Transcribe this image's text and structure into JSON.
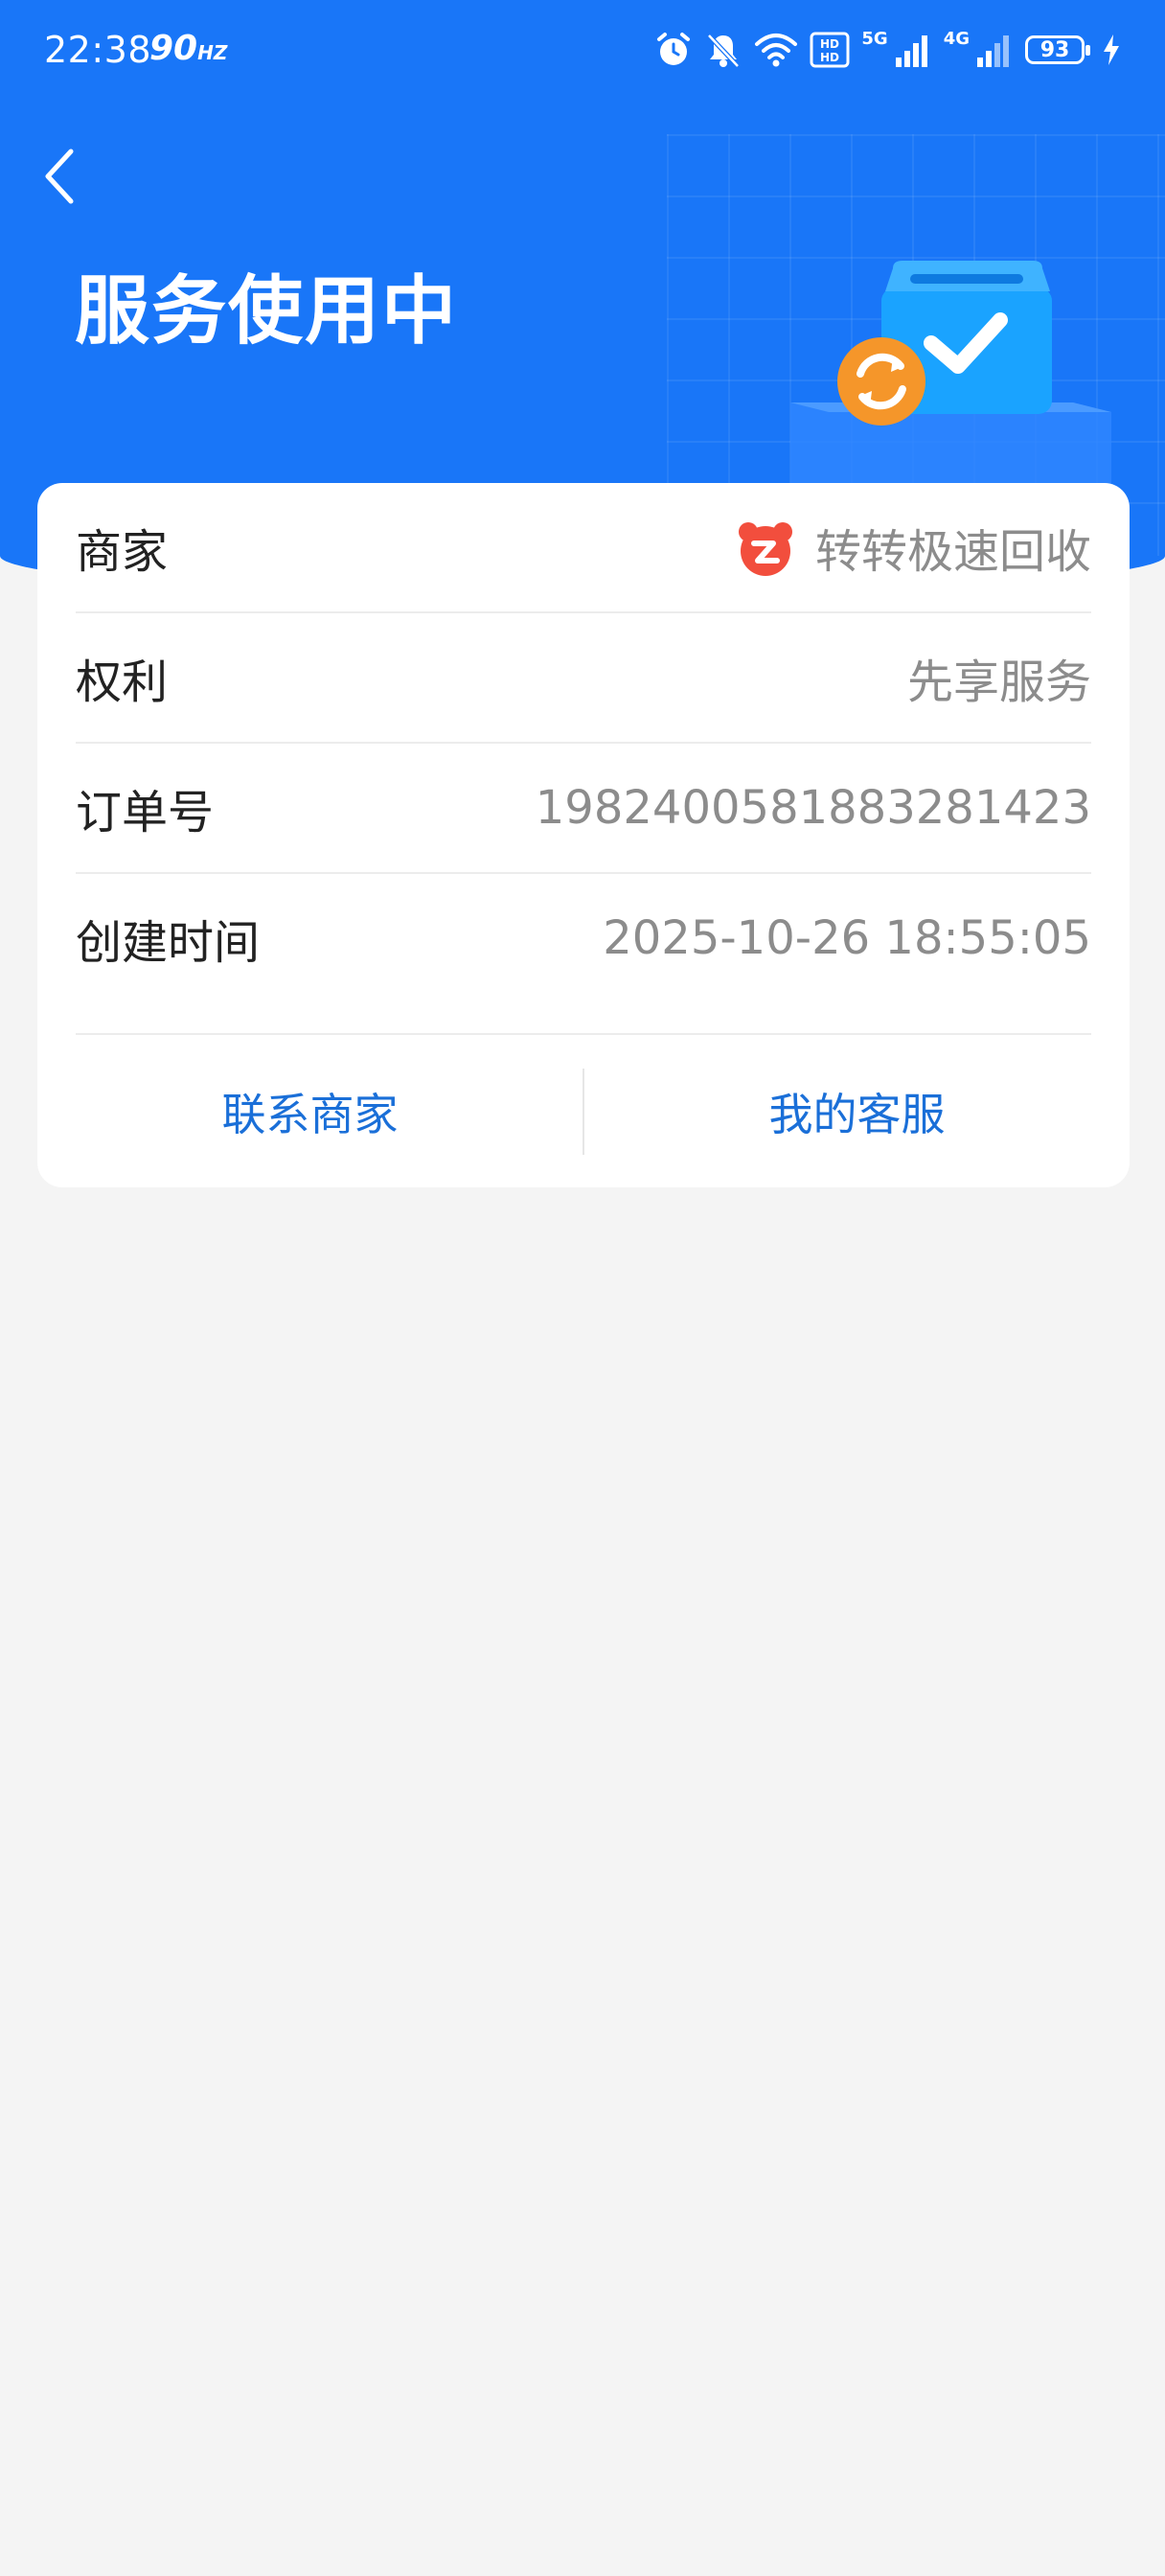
{
  "status_bar": {
    "time": "22:38",
    "refresh_rate": "90",
    "refresh_unit": "HZ",
    "network_5g": "5G",
    "network_4g": "4G",
    "battery": "93",
    "icons": [
      "alarm-icon",
      "mute-bell-icon",
      "wifi-icon",
      "hd-icon",
      "signal-icon",
      "battery-icon",
      "charging-icon"
    ]
  },
  "header": {
    "title": "服务使用中",
    "background_color": "#1976f8"
  },
  "details": {
    "merchant": {
      "label": "商家",
      "value": "转转极速回收"
    },
    "rights": {
      "label": "权利",
      "value": "先享服务"
    },
    "order_no": {
      "label": "订单号",
      "value": "1982400581883281423"
    },
    "created_at": {
      "label": "创建时间",
      "value": "2025-10-26 18:55:05"
    }
  },
  "actions": {
    "contact_merchant": "联系商家",
    "my_service": "我的客服"
  },
  "colors": {
    "accent": "#1a6fd8",
    "merchant_logo": "#f24e3d",
    "illustration_orange": "#f5962a"
  }
}
